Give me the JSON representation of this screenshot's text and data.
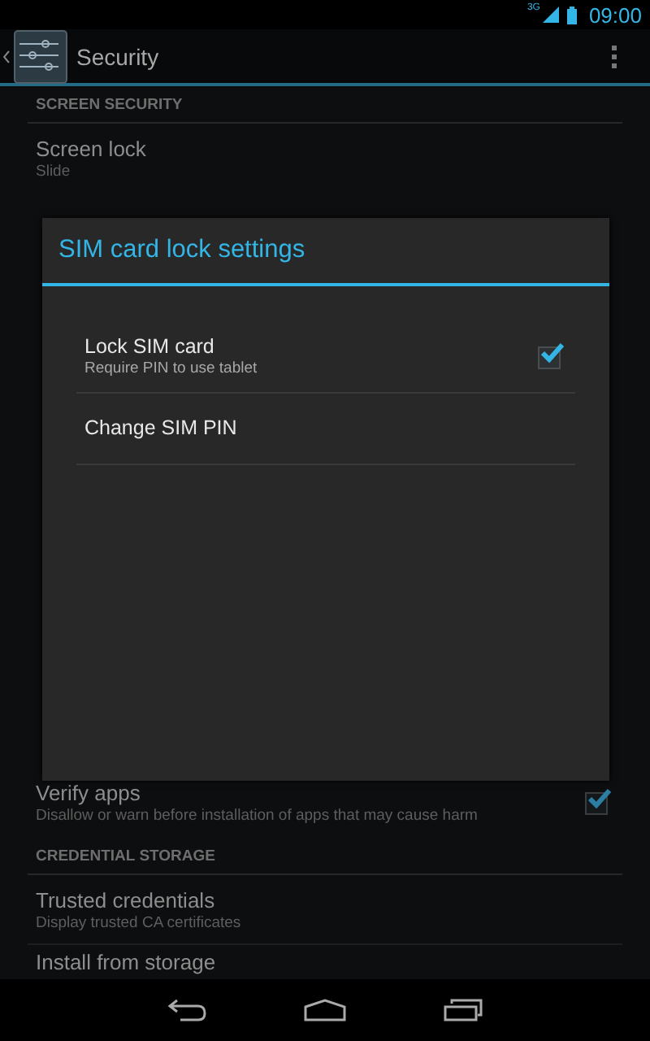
{
  "status_bar": {
    "network": "3G",
    "time": "09:00"
  },
  "action_bar": {
    "title": "Security"
  },
  "sections": [
    {
      "header": "SCREEN SECURITY",
      "items": [
        {
          "title": "Screen lock",
          "summary_lines": [
            "Slide"
          ]
        }
      ]
    },
    {
      "items": [
        {
          "title": "Verify apps",
          "summary_lines": [
            "Disallow or warn before installation of apps that may cause harm"
          ],
          "checked": true
        }
      ]
    },
    {
      "header": "CREDENTIAL STORAGE",
      "items": [
        {
          "title": "Trusted credentials",
          "summary_lines": [
            "Display trusted CA certificates"
          ]
        },
        {
          "title": "Install from storage"
        }
      ]
    }
  ],
  "dialog": {
    "title": "SIM card lock settings",
    "items": [
      {
        "title": "Lock SIM card",
        "summary": "Require PIN to use tablet",
        "checked": true
      },
      {
        "title": "Change SIM PIN"
      }
    ]
  }
}
